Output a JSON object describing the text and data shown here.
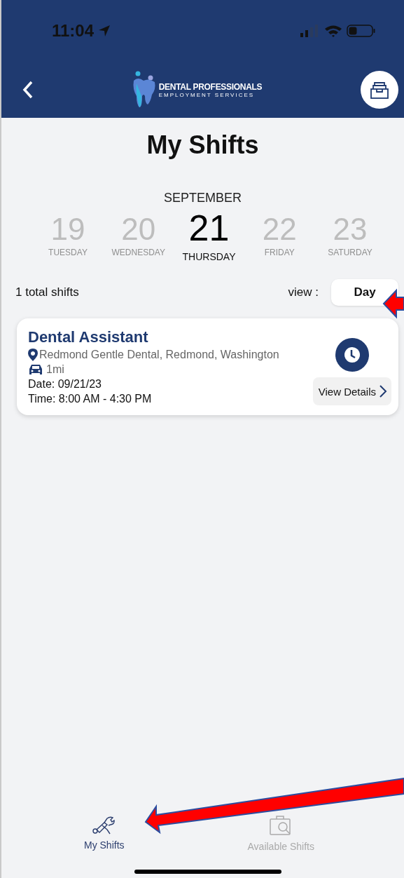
{
  "status_bar": {
    "time": "11:04"
  },
  "header": {
    "logo_line_1": "DENTAL PROFESSIONALS",
    "logo_line_2": "EMPLOYMENT SERVICES"
  },
  "title": "My Shifts",
  "calendar": {
    "month": "SEPTEMBER",
    "days": [
      {
        "date": "19",
        "weekday": "TUESDAY",
        "selected": false
      },
      {
        "date": "20",
        "weekday": "WEDNESDAY",
        "selected": false
      },
      {
        "date": "21",
        "weekday": "THURSDAY",
        "selected": true
      },
      {
        "date": "22",
        "weekday": "FRIDAY",
        "selected": false
      },
      {
        "date": "23",
        "weekday": "SATURDAY",
        "selected": false
      }
    ]
  },
  "summary": {
    "total": "1 total shifts",
    "view_label": "view :",
    "view_value": "Day"
  },
  "shifts": [
    {
      "title": "Dental Assistant",
      "location": "Redmond Gentle Dental, Redmond, Washington",
      "distance": "1mi",
      "date": "Date: 09/21/23",
      "time": "Time: 8:00 AM - 4:30 PM",
      "action": "View Details"
    }
  ],
  "tabs": [
    {
      "label": "My Shifts",
      "kind": "tools",
      "selected": true
    },
    {
      "label": "Available Shifts",
      "kind": "search",
      "selected": false
    }
  ]
}
